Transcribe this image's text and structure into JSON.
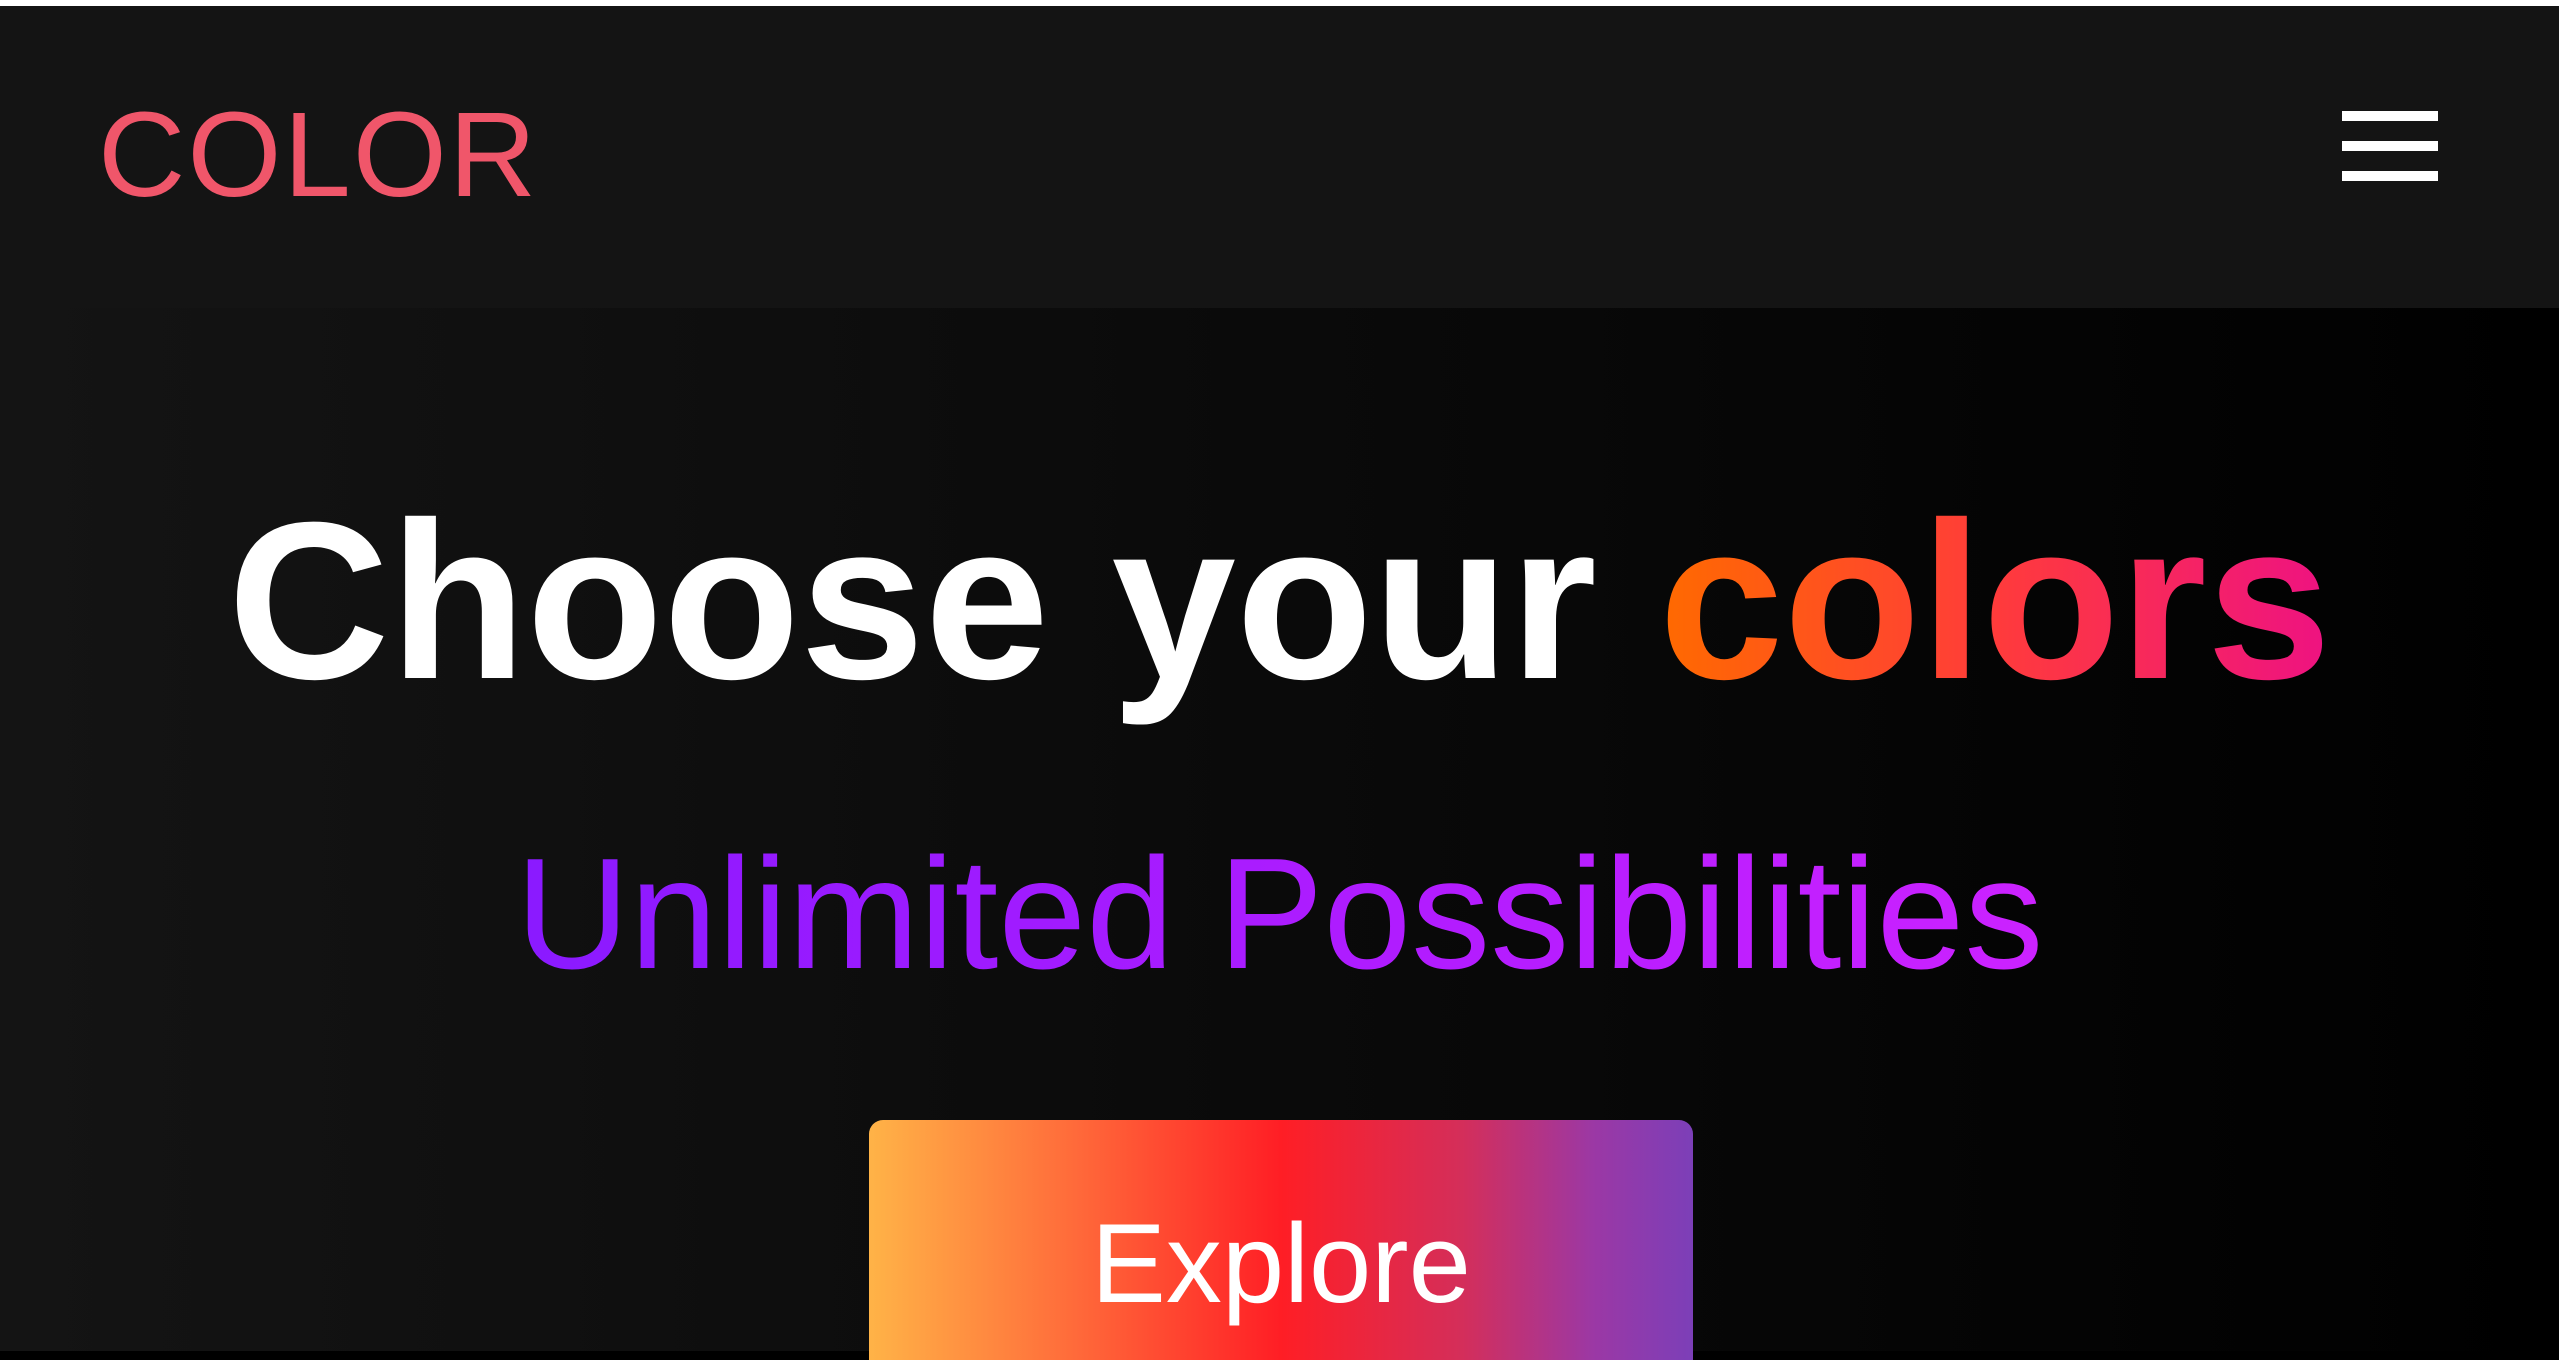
{
  "navbar": {
    "logo_text": "COLOR",
    "menu_icon": "hamburger-menu-icon"
  },
  "hero": {
    "headline_prefix": "Choose your",
    "headline_accent": "colors",
    "subtitle": "Unlimited Possibilities",
    "cta_label": "Explore"
  },
  "colors": {
    "navbar_background": "#141414",
    "logo": "#f0566a",
    "headline": "#ffffff",
    "accent_gradient": [
      "#ff6a00",
      "#ff3b3b",
      "#ee1282"
    ],
    "subtitle_gradient": [
      "#8a1aff",
      "#cc22ff"
    ],
    "button_gradient": [
      "#ffb347",
      "#ff1e25",
      "#7c3fb8"
    ]
  }
}
